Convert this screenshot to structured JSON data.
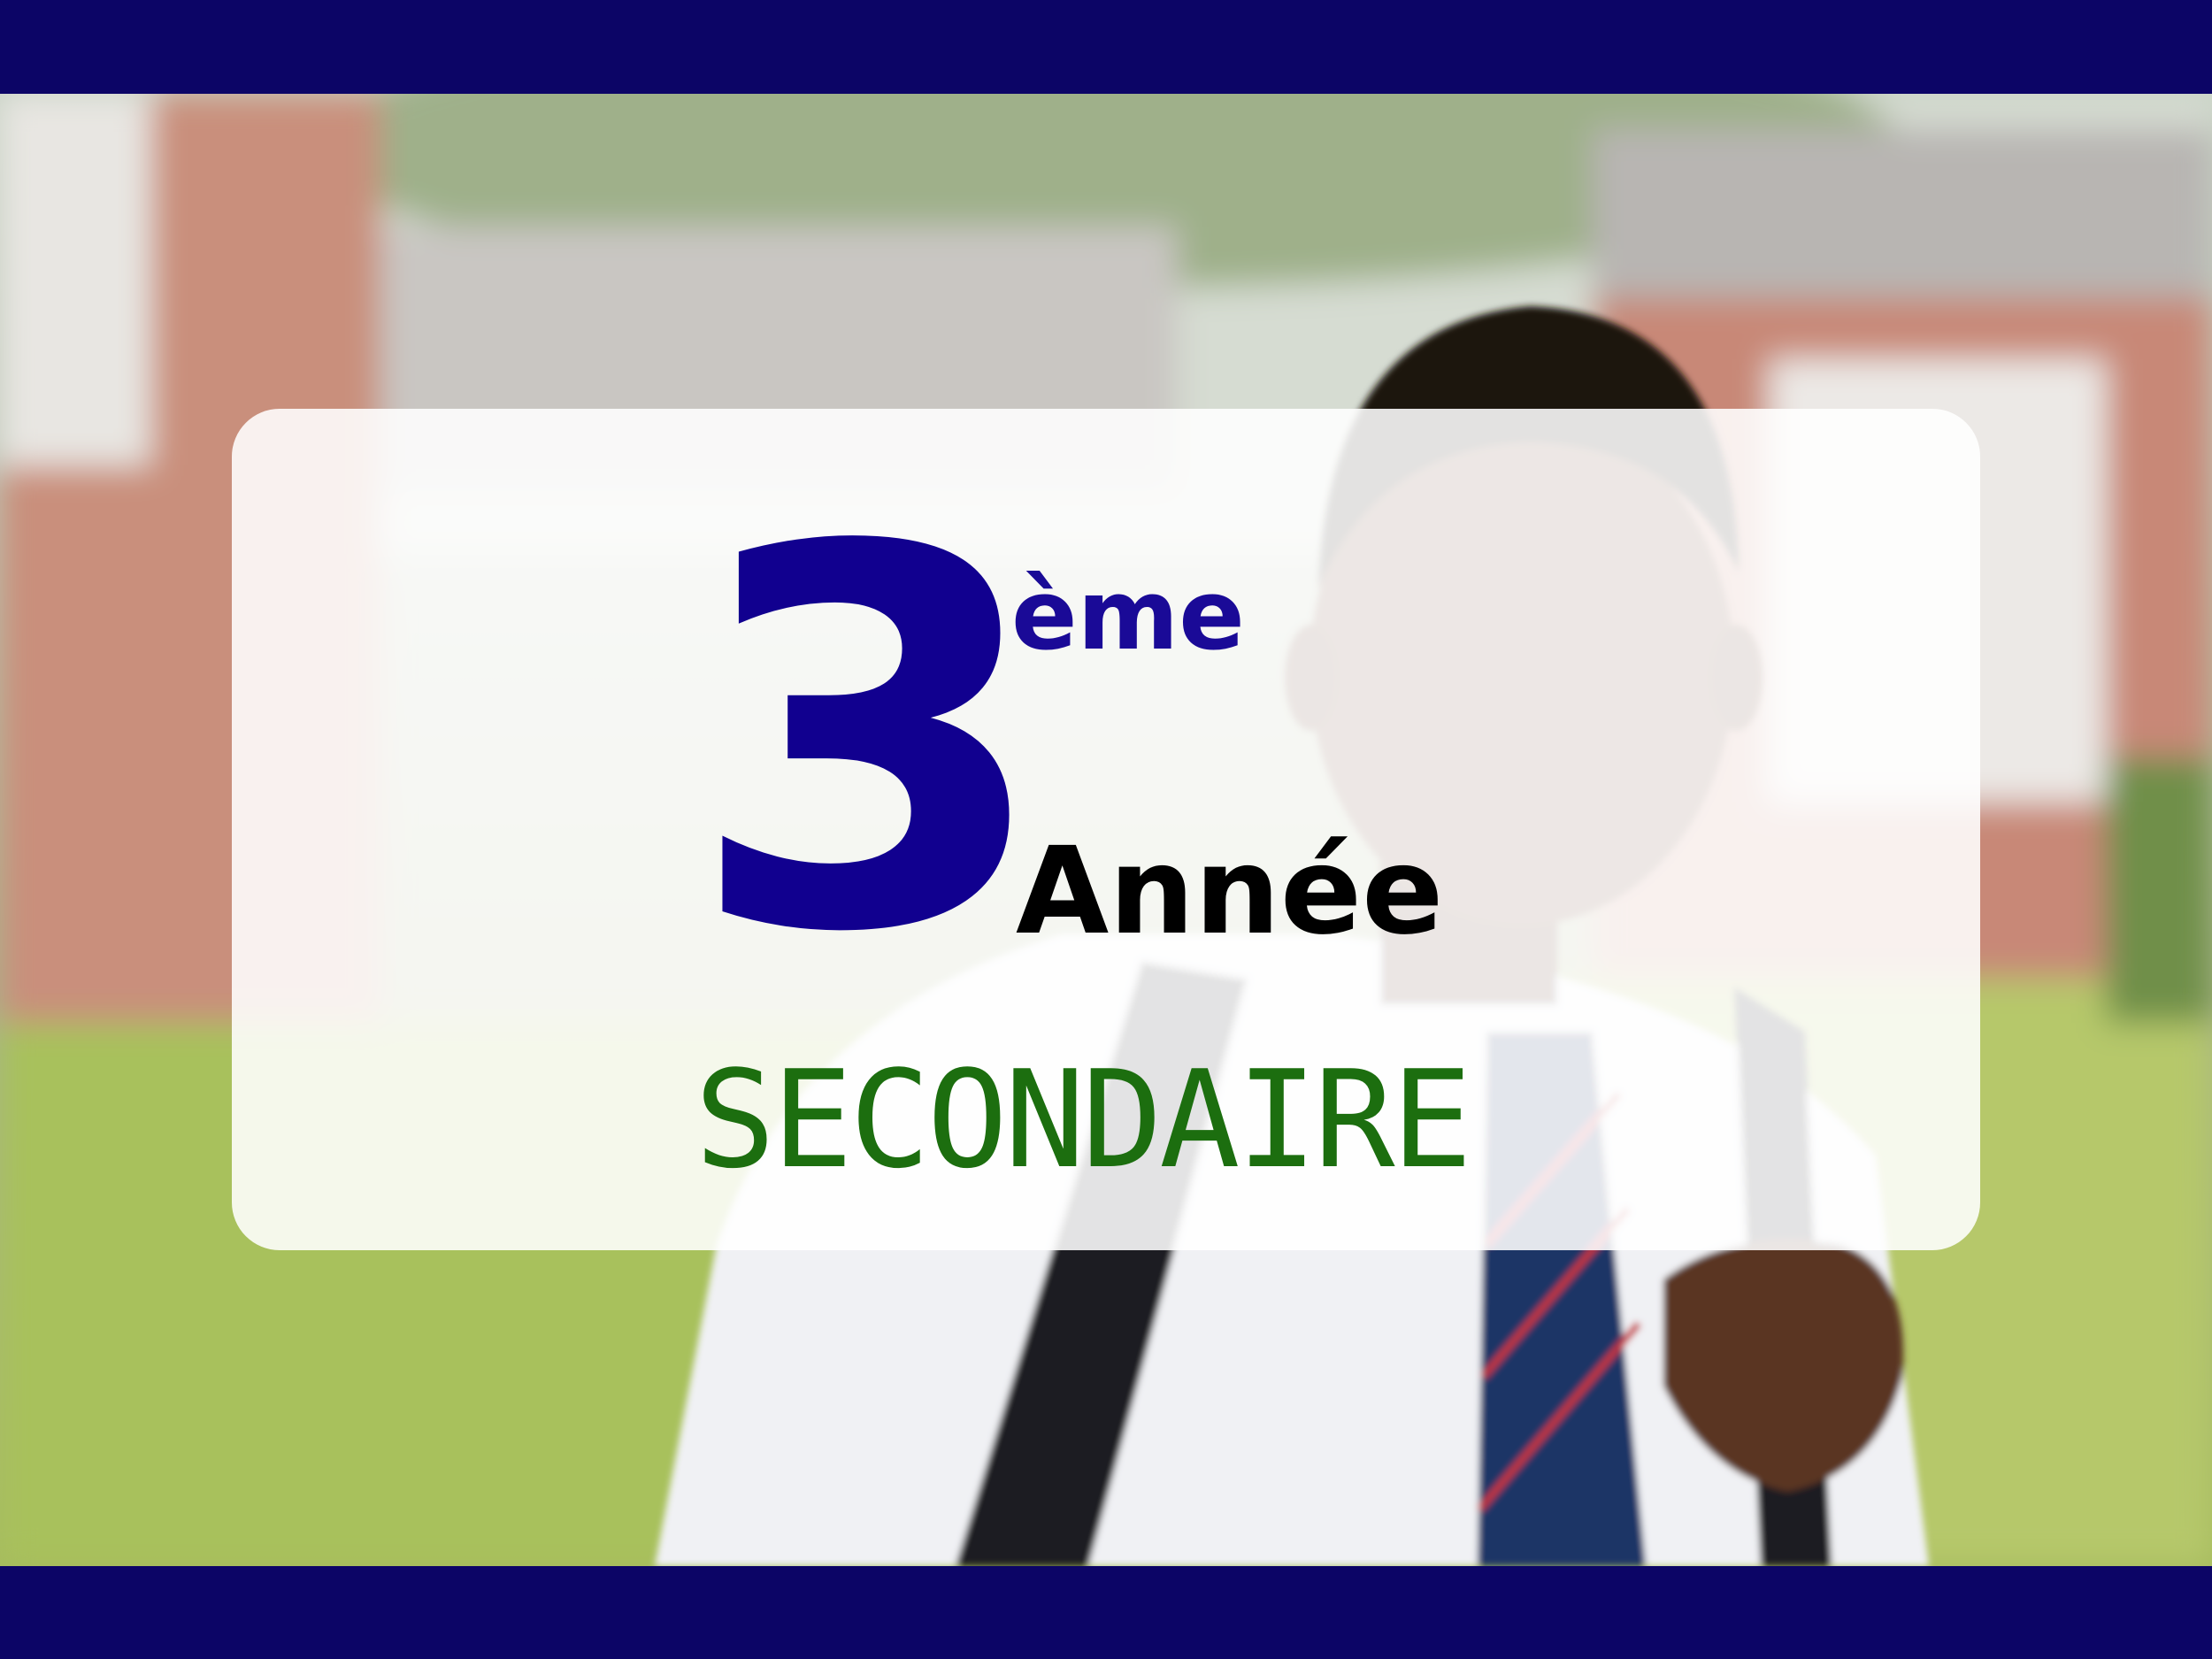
{
  "banner": {
    "grade_number": "3",
    "grade_suffix": "ème",
    "grade_word": "Année",
    "level": "SECONDAIRE"
  },
  "photo": {
    "subject": "smiling-student-in-school-uniform-with-backpack"
  },
  "colors": {
    "frame_bar": "#0c0566",
    "grade_number": "#11008f",
    "grade_suffix": "#1a0a97",
    "grade_word": "#000000",
    "level": "#1c6e0f",
    "card_background": "#ffffff"
  }
}
